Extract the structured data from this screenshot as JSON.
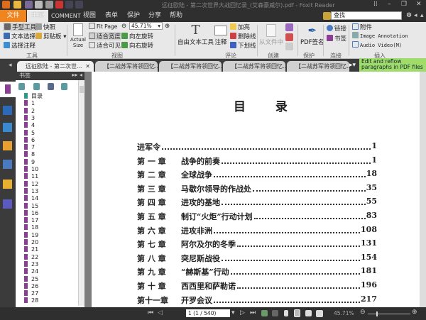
{
  "window": {
    "title": "远征欧陆 - 第二次世界大战回忆录_(艾森豪威尔).pdf - Foxit Reader"
  },
  "menu": [
    "文件",
    "主页",
    "COMMENT",
    "视图",
    "表单",
    "保护",
    "分享",
    "帮助"
  ],
  "ribbon": {
    "tools": {
      "hand": "手型工具",
      "snapshot": "快照",
      "select_text": "文本选择",
      "clipboard": "剪贴板",
      "select_annot": "选择注释",
      "label": "工具"
    },
    "view": {
      "actual_size": "Actual Size",
      "fit_page": "Fit Page",
      "fit_width": "适合宽度",
      "fit_visible": "适合可见",
      "rotate_left": "向左旋转",
      "rotate_right": "向右旋转",
      "zoom": "45.71%",
      "label": "视图"
    },
    "comment": {
      "typewriter": "自由文本工具",
      "note": "注释",
      "highlight": "加亮",
      "strikeout": "删除线",
      "underline": "下划线",
      "label": "评论"
    },
    "create": {
      "from_file": "从文件中",
      "label": "创建"
    },
    "protect": {
      "sign": "PDF签名",
      "label": "保护"
    },
    "links": {
      "link": "链接",
      "bookmark": "书签",
      "label": "连接"
    },
    "insert": {
      "attachment": "附件",
      "image": "Image Annotation",
      "av": "Audio  Video(M)",
      "label": "插入"
    },
    "search_placeholder": "查找"
  },
  "tabs": [
    "远征欧陆 - 第二次世...",
    "【二战苏军将领回忆...",
    "【二战苏军将领回忆...",
    "【二战苏军将领回忆...",
    "【二战苏军将领回忆..."
  ],
  "tip": "Edit and reflow paragraphs in PDF files",
  "panel": {
    "title": "书签",
    "bookmarks": [
      "目录",
      "1",
      "2",
      "3",
      "4",
      "5",
      "6",
      "7",
      "8",
      "9",
      "10",
      "11",
      "12",
      "13",
      "14",
      "15",
      "16",
      "17",
      "18",
      "19",
      "20",
      "21",
      "22",
      "23",
      "24",
      "25",
      "26",
      "27",
      "28"
    ]
  },
  "page": {
    "title": "目 录",
    "entries": [
      {
        "c": "进军令",
        "t": "",
        "p": "1"
      },
      {
        "c": "第 一 章",
        "t": "战争的前奏",
        "p": "1"
      },
      {
        "c": "第 二 章",
        "t": "全球战争",
        "p": "18"
      },
      {
        "c": "第 三 章",
        "t": "马歇尔领导的作战处",
        "p": "35"
      },
      {
        "c": "第 四 章",
        "t": "进攻的基地",
        "p": "55"
      },
      {
        "c": "第 五 章",
        "t": "制订“火炬”行动计划",
        "p": "83"
      },
      {
        "c": "第 六 章",
        "t": "进攻非洲",
        "p": "108"
      },
      {
        "c": "第 七 章",
        "t": "阿尔及尔的冬季",
        "p": "131"
      },
      {
        "c": "第 八 章",
        "t": "突尼斯战役",
        "p": "154"
      },
      {
        "c": "第 九 章",
        "t": "“赫斯基”行动",
        "p": "181"
      },
      {
        "c": "第 十 章",
        "t": "西西里和萨勒诺",
        "p": "196"
      },
      {
        "c": "第十一章",
        "t": "开罗会议",
        "p": "217"
      }
    ]
  },
  "status": {
    "page": "1 (1 / 540)",
    "zoom": "45.71%"
  }
}
